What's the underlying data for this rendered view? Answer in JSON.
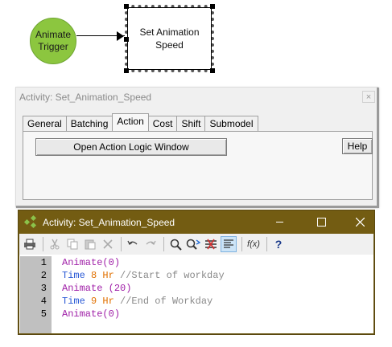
{
  "diagram": {
    "trigger_label": "Animate\nTrigger",
    "activity_label": "Set Animation\nSpeed",
    "trigger_color": "#8cc63f"
  },
  "dialog": {
    "title": "Activity: Set_Animation_Speed",
    "close_glyph": "×",
    "tabs": [
      "General",
      "Batching",
      "Action",
      "Cost",
      "Shift",
      "Submodel"
    ],
    "active_tab": "Action",
    "open_button": "Open Action Logic Window",
    "help_button": "Help"
  },
  "editor": {
    "title": "Activity: Set_Animation_Speed",
    "title_bar_color": "#735c12",
    "toolbar_icons": [
      "print-icon",
      "cut-icon",
      "copy-icon",
      "paste-icon",
      "delete-icon",
      "undo-icon",
      "redo-icon",
      "find-icon",
      "find-replace-icon",
      "compare-icon",
      "format-icon",
      "function-icon",
      "help-icon"
    ],
    "function_label": "f(x)",
    "help_label": "?",
    "line_numbers": [
      "1",
      "2",
      "3",
      "4",
      "5"
    ],
    "lines": [
      {
        "kw": "Animate",
        "rest": "(0)",
        "unit": "",
        "comment": ""
      },
      {
        "kw": "Time",
        "rest": " 8 ",
        "unit": "Hr",
        "comment": " //Start of workday"
      },
      {
        "kw": "Animate",
        "rest": " (20)",
        "unit": "",
        "comment": ""
      },
      {
        "kw": "Time",
        "rest": " 9 ",
        "unit": "Hr",
        "comment": " //End of Workday"
      },
      {
        "kw": "Animate",
        "rest": "(0)",
        "unit": "",
        "comment": ""
      }
    ]
  }
}
